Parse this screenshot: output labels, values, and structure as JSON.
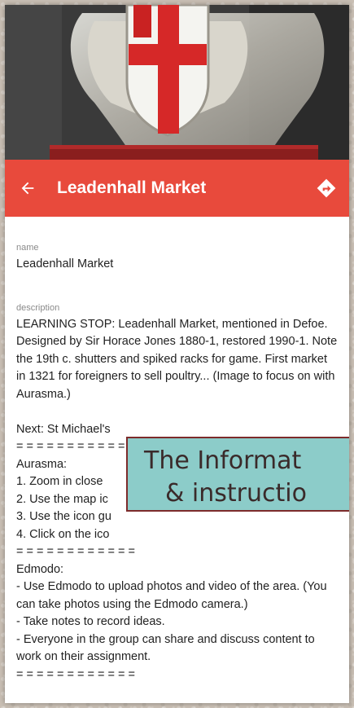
{
  "appbar": {
    "title": "Leadenhall Market",
    "back_icon": "arrow-left-icon",
    "directions_icon": "directions-icon"
  },
  "fields": {
    "name_label": "name",
    "name_value": "Leadenhall Market",
    "description_label": "description",
    "description_value": "LEARNING STOP: Leadenhall Market, mentioned in Defoe. Designed by Sir Horace Jones 1880-1, restored 1990-1. Note the 19th c. shutters and spiked racks for game. First market in 1321 for foreigners to sell poultry... (Image to focus on with Aurasma.)\n\nNext: St Michael's\n= = = = = = = = = = = =\nAurasma:\n1. Zoom in close\n2. Use the map ic\n3. Use the icon gu\n4. Click on the ico\n= = = = = = = = = = = =\nEdmodo:\n- Use Edmodo to upload photos and video of the area. (You can take photos using the Edmodo camera.)\n- Take notes to record ideas.\n- Everyone in the group can share and discuss content to work on their assignment.\n= = = = = = = = = = = ="
  },
  "overlay": {
    "line1": "The Informat",
    "line2": "& instructio"
  },
  "colors": {
    "appbar": "#e84a3c",
    "overlay_bg": "#8cccc9",
    "overlay_border": "#7d2b2b"
  }
}
